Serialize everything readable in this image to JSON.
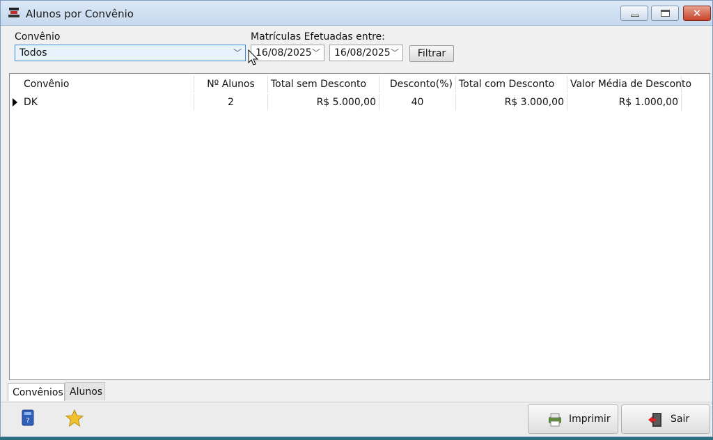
{
  "window": {
    "title": "Alunos por Convênio"
  },
  "filters": {
    "convenio_label": "Convênio",
    "convenio_value": "Todos",
    "periodo_label": "Matrículas Efetuadas entre:",
    "date_from": "16/08/2025",
    "date_to": "16/08/2025",
    "filtrar_label": "Filtrar"
  },
  "table": {
    "columns": [
      "Convênio",
      "Nº Alunos",
      "Total sem Desconto",
      "Desconto(%)",
      "Total com Desconto",
      "Valor Média de Desconto"
    ],
    "rows": [
      [
        "DK",
        "2",
        "R$ 5.000,00",
        "40",
        "R$ 3.000,00",
        "R$ 1.000,00"
      ]
    ]
  },
  "tabs": [
    "Convênios",
    "Alunos"
  ],
  "footer": {
    "imprimir_label": "Imprimir",
    "sair_label": "Sair"
  },
  "icons": [
    "app-icon",
    "help-book-icon",
    "star-icon",
    "printer-icon",
    "exit-door-icon"
  ]
}
